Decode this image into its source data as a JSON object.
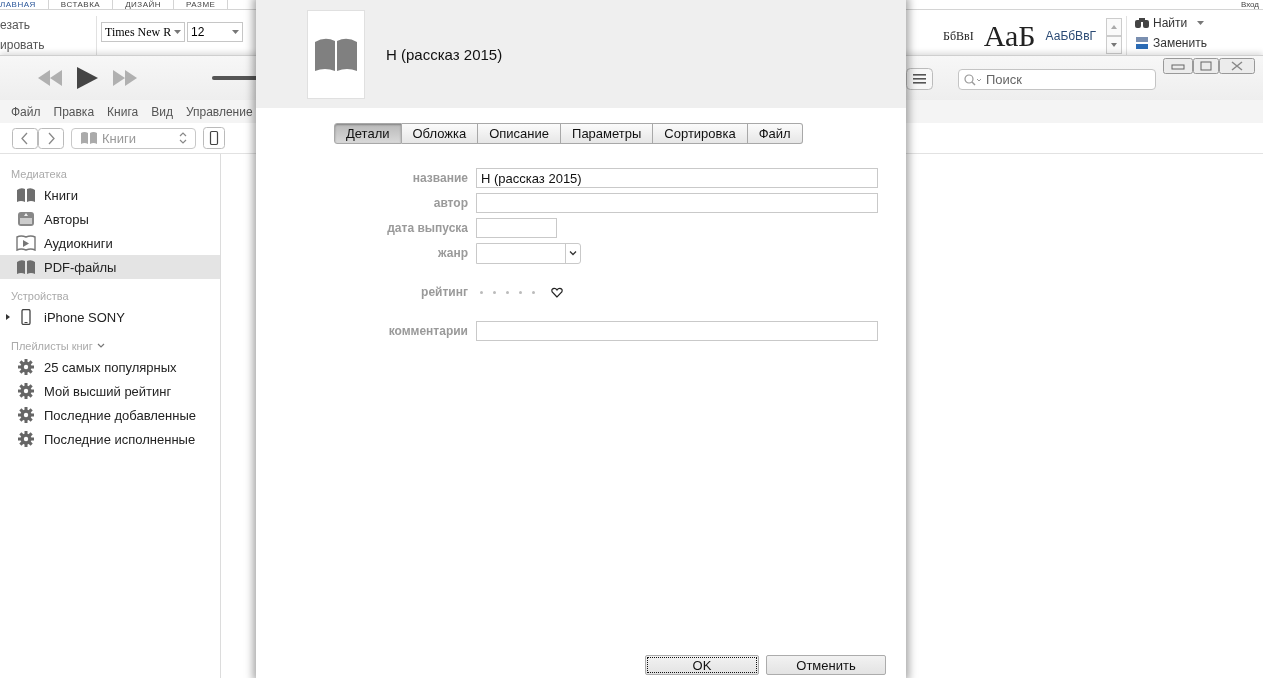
{
  "word_ribbon": {
    "tabs": [
      {
        "label": "ЛАВНАЯ",
        "selected": true
      },
      {
        "label": "ВСТАВКА",
        "selected": false
      },
      {
        "label": "ДИЗАЙН",
        "selected": false
      },
      {
        "label": "РАЗМЕ",
        "selected": false
      }
    ],
    "account": "Вход",
    "clipboard": [
      "езать",
      "ировать"
    ],
    "font_name": "Times New R",
    "font_size": "12",
    "styles": [
      "БбВвI",
      "АаБ",
      "АаБбВвГ"
    ],
    "editing": [
      {
        "kind": "find",
        "label": "Найти"
      },
      {
        "kind": "replace",
        "label": "Заменить"
      }
    ]
  },
  "itunes": {
    "volume": {
      "level": 1
    },
    "search": {
      "placeholder": "Поиск"
    },
    "menu": [
      "Файл",
      "Правка",
      "Книга",
      "Вид",
      "Управление"
    ],
    "media_picker": "Книги",
    "sidebar": [
      {
        "title": "Медиатека",
        "items": [
          {
            "label": "Книги",
            "kind": "book",
            "selected": false
          },
          {
            "label": "Авторы",
            "kind": "authors",
            "selected": false
          },
          {
            "label": "Аудиокниги",
            "kind": "audiobook",
            "selected": false
          },
          {
            "label": "PDF-файлы",
            "kind": "book",
            "selected": true
          }
        ]
      },
      {
        "title": "Устройства",
        "items": [
          {
            "label": "iPhone SONY",
            "kind": "device",
            "selected": false,
            "expanded": false
          }
        ]
      },
      {
        "title": "Плейлисты книг",
        "expanded": true,
        "items": [
          {
            "label": "25 самых популярных",
            "kind": "smart",
            "selected": false
          },
          {
            "label": "Мой высший рейтинг",
            "kind": "smart",
            "selected": false
          },
          {
            "label": "Последние добавленные",
            "kind": "smart",
            "selected": false
          },
          {
            "label": "Последние исполненные",
            "kind": "smart",
            "selected": false
          }
        ]
      }
    ]
  },
  "dialog": {
    "title": "Н (рассказ 2015)",
    "tabs": [
      {
        "label": "Детали",
        "selected": true
      },
      {
        "label": "Обложка",
        "selected": false
      },
      {
        "label": "Описание",
        "selected": false
      },
      {
        "label": "Параметры",
        "selected": false
      },
      {
        "label": "Сортировка",
        "selected": false
      },
      {
        "label": "Файл",
        "selected": false
      }
    ],
    "fields": [
      {
        "kind": "text",
        "label": "название",
        "value": "Н (рассказ 2015)"
      },
      {
        "kind": "text",
        "label": "автор"
      },
      {
        "kind": "short",
        "label": "дата выпуска"
      },
      {
        "kind": "select",
        "label": "жанр"
      },
      {
        "kind": "rating",
        "label": "рейтинг",
        "stars": 0,
        "loved": false
      },
      {
        "kind": "text",
        "label": "комментарии"
      }
    ],
    "buttons": [
      {
        "label": "OK",
        "focused": true
      },
      {
        "label": "Отменить",
        "focused": false
      }
    ]
  }
}
